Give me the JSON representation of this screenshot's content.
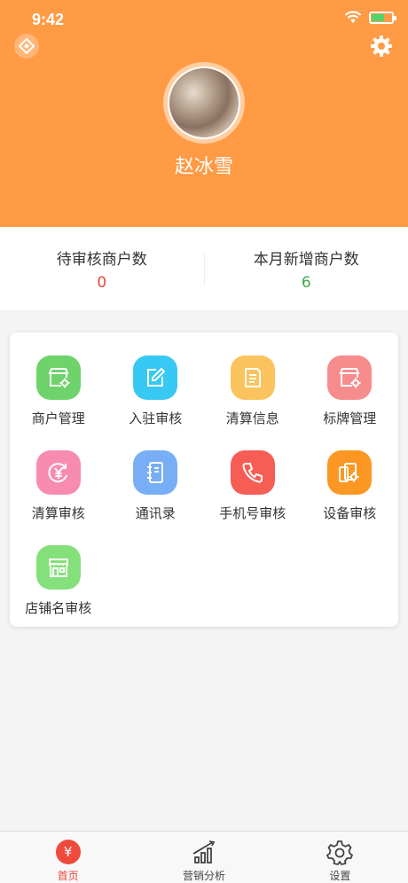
{
  "status": {
    "time": "9:42"
  },
  "profile": {
    "name": "赵冰雪"
  },
  "stats": [
    {
      "label": "待审核商户数",
      "value": "0",
      "color": "#e8483a"
    },
    {
      "label": "本月新增商户数",
      "value": "6",
      "color": "#3dac4a"
    }
  ],
  "menu": [
    {
      "label": "商户管理",
      "icon": "shop-settings-icon",
      "color": "#6dd36a"
    },
    {
      "label": "入驻审核",
      "icon": "edit-icon",
      "color": "#38c8f4"
    },
    {
      "label": "清算信息",
      "icon": "document-icon",
      "color": "#fbc35e"
    },
    {
      "label": "标牌管理",
      "icon": "shop-sign-icon",
      "color": "#f78c8c"
    },
    {
      "label": "清算审核",
      "icon": "yuan-refresh-icon",
      "color": "#f78cb0"
    },
    {
      "label": "通讯录",
      "icon": "address-book-icon",
      "color": "#77aef5"
    },
    {
      "label": "手机号审核",
      "icon": "phone-icon",
      "color": "#f65d54"
    },
    {
      "label": "设备审核",
      "icon": "device-settings-icon",
      "color": "#fb9722"
    },
    {
      "label": "店铺名审核",
      "icon": "storefront-icon",
      "color": "#84e07a"
    }
  ],
  "tabs": [
    {
      "label": "首页",
      "icon": "yuan-home-icon",
      "active": true
    },
    {
      "label": "营销分析",
      "icon": "bar-chart-icon",
      "active": false
    },
    {
      "label": "设置",
      "icon": "gear-icon",
      "active": false
    }
  ]
}
